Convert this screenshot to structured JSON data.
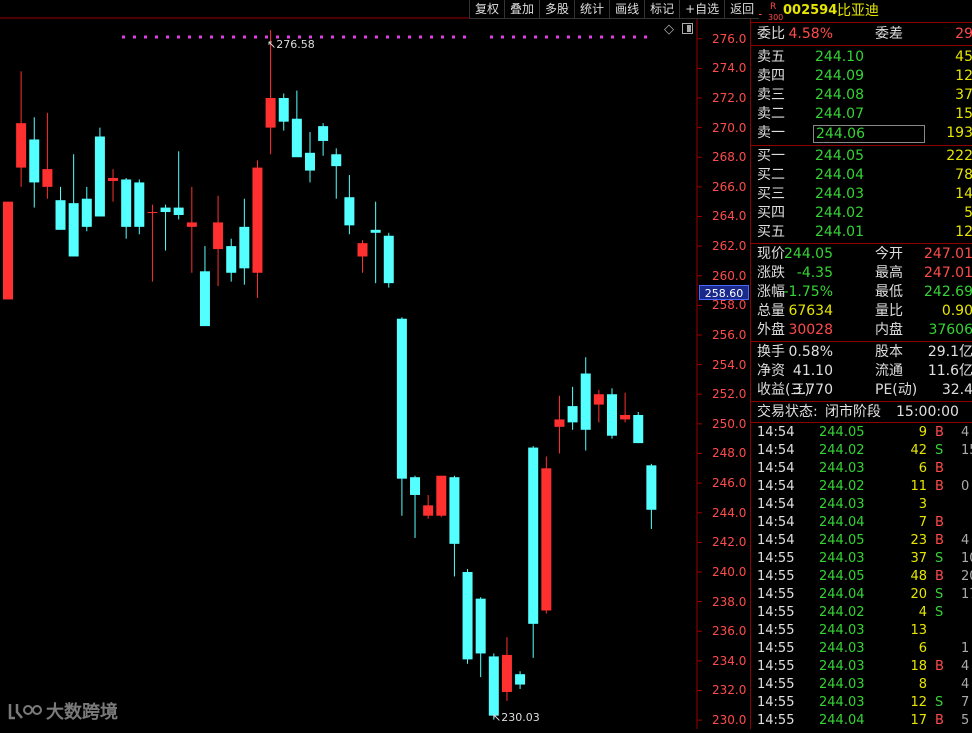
{
  "toolbar": {
    "buttons": [
      "复权",
      "叠加",
      "多股",
      "统计",
      "画线",
      "标记",
      "+自选",
      "返回"
    ]
  },
  "chart": {
    "y_ticks": [
      "276.0",
      "274.0",
      "272.0",
      "270.0",
      "268.0",
      "266.0",
      "264.0",
      "262.0",
      "260.0",
      "258.0",
      "256.0",
      "254.0",
      "252.0",
      "250.0",
      "248.0",
      "246.0",
      "244.0",
      "242.0",
      "240.0",
      "238.0",
      "236.0",
      "234.0",
      "232.0",
      "230.0"
    ],
    "current_price_marker": "258.60",
    "high_annotation": "276.58",
    "low_annotation": "230.03",
    "up_color": "#ff3030",
    "down_color": "#54ffff"
  },
  "chart_data": {
    "type": "candlestick",
    "ylim": [
      229.4,
      277.4
    ],
    "candles": [
      {
        "o": 258.4,
        "h": 265.0,
        "l": 258.4,
        "c": 265.0
      },
      {
        "o": 267.3,
        "h": 273.8,
        "l": 266.0,
        "c": 270.3
      },
      {
        "o": 269.2,
        "h": 270.7,
        "l": 264.6,
        "c": 266.3
      },
      {
        "o": 266.0,
        "h": 271.0,
        "l": 265.2,
        "c": 267.2
      },
      {
        "o": 265.1,
        "h": 266.0,
        "l": 263.1,
        "c": 263.1
      },
      {
        "o": 264.9,
        "h": 268.2,
        "l": 261.7,
        "c": 261.3
      },
      {
        "o": 265.2,
        "h": 266.0,
        "l": 263.0,
        "c": 263.3
      },
      {
        "o": 269.4,
        "h": 270.0,
        "l": 264.0,
        "c": 264.0
      },
      {
        "o": 266.4,
        "h": 267.2,
        "l": 265.0,
        "c": 266.6
      },
      {
        "o": 266.5,
        "h": 266.6,
        "l": 262.5,
        "c": 263.3
      },
      {
        "o": 266.3,
        "h": 266.5,
        "l": 262.8,
        "c": 263.3
      },
      {
        "o": 264.3,
        "h": 264.8,
        "l": 259.6,
        "c": 264.3
      },
      {
        "o": 264.6,
        "h": 264.8,
        "l": 261.7,
        "c": 264.3
      },
      {
        "o": 264.6,
        "h": 268.4,
        "l": 263.8,
        "c": 264.1
      },
      {
        "o": 263.3,
        "h": 266.0,
        "l": 260.2,
        "c": 263.6
      },
      {
        "o": 260.3,
        "h": 262.0,
        "l": 256.6,
        "c": 256.6
      },
      {
        "o": 261.8,
        "h": 265.4,
        "l": 259.3,
        "c": 263.6
      },
      {
        "o": 262.0,
        "h": 262.5,
        "l": 259.6,
        "c": 260.2
      },
      {
        "o": 263.3,
        "h": 265.2,
        "l": 259.4,
        "c": 260.5
      },
      {
        "o": 260.2,
        "h": 267.8,
        "l": 258.5,
        "c": 267.3
      },
      {
        "o": 270.0,
        "h": 276.58,
        "l": 268.2,
        "c": 272.0
      },
      {
        "o": 272.0,
        "h": 272.3,
        "l": 269.8,
        "c": 270.4
      },
      {
        "o": 270.6,
        "h": 272.5,
        "l": 268.2,
        "c": 268.0
      },
      {
        "o": 268.3,
        "h": 269.7,
        "l": 266.3,
        "c": 267.1
      },
      {
        "o": 270.1,
        "h": 270.3,
        "l": 268.1,
        "c": 269.1
      },
      {
        "o": 268.2,
        "h": 268.6,
        "l": 265.2,
        "c": 267.4
      },
      {
        "o": 265.3,
        "h": 266.8,
        "l": 262.8,
        "c": 263.4
      },
      {
        "o": 261.3,
        "h": 262.4,
        "l": 260.2,
        "c": 262.2
      },
      {
        "o": 263.1,
        "h": 265.0,
        "l": 259.5,
        "c": 262.9
      },
      {
        "o": 262.7,
        "h": 262.9,
        "l": 259.2,
        "c": 259.5
      },
      {
        "o": 257.1,
        "h": 257.2,
        "l": 243.8,
        "c": 246.3
      },
      {
        "o": 246.4,
        "h": 246.5,
        "l": 242.3,
        "c": 245.2
      },
      {
        "o": 243.8,
        "h": 245.2,
        "l": 243.6,
        "c": 244.5
      },
      {
        "o": 243.8,
        "h": 246.4,
        "l": 243.7,
        "c": 246.5
      },
      {
        "o": 246.4,
        "h": 246.5,
        "l": 239.7,
        "c": 241.9
      },
      {
        "o": 240.0,
        "h": 240.2,
        "l": 233.8,
        "c": 234.1
      },
      {
        "o": 238.2,
        "h": 238.3,
        "l": 232.9,
        "c": 234.5
      },
      {
        "o": 234.3,
        "h": 234.5,
        "l": 230.03,
        "c": 230.3
      },
      {
        "o": 231.9,
        "h": 235.6,
        "l": 231.3,
        "c": 234.4
      },
      {
        "o": 233.1,
        "h": 233.3,
        "l": 232.1,
        "c": 232.4
      },
      {
        "o": 248.4,
        "h": 248.5,
        "l": 234.2,
        "c": 236.5
      },
      {
        "o": 237.4,
        "h": 247.8,
        "l": 237.2,
        "c": 247.0
      },
      {
        "o": 249.8,
        "h": 251.9,
        "l": 248.0,
        "c": 250.3
      },
      {
        "o": 251.2,
        "h": 252.5,
        "l": 249.6,
        "c": 250.1
      },
      {
        "o": 253.4,
        "h": 254.5,
        "l": 248.2,
        "c": 249.6
      },
      {
        "o": 251.3,
        "h": 252.3,
        "l": 250.1,
        "c": 252.0
      },
      {
        "o": 252.0,
        "h": 252.4,
        "l": 249.0,
        "c": 249.2
      },
      {
        "o": 250.3,
        "h": 252.1,
        "l": 250.1,
        "c": 250.6
      },
      {
        "o": 250.6,
        "h": 250.8,
        "l": 248.7,
        "c": 248.7
      },
      {
        "o": 247.2,
        "h": 247.3,
        "l": 242.9,
        "c": 244.2
      }
    ]
  },
  "quote": {
    "stock_code": "002594",
    "stock_name": "比亚迪",
    "badge_l": "L",
    "badge_r": "R",
    "badge_300": "300",
    "weibi_label": "委比",
    "weibi_value": "4.58%",
    "weicha_label": "委差",
    "weicha_value": "29",
    "asks": [
      {
        "label": "卖五",
        "price": "244.10",
        "vol": "45"
      },
      {
        "label": "卖四",
        "price": "244.09",
        "vol": "12"
      },
      {
        "label": "卖三",
        "price": "244.08",
        "vol": "37"
      },
      {
        "label": "卖二",
        "price": "244.07",
        "vol": "15"
      },
      {
        "label": "卖一",
        "price": "244.06",
        "vol": "193"
      }
    ],
    "bids": [
      {
        "label": "买一",
        "price": "244.05",
        "vol": "222"
      },
      {
        "label": "买二",
        "price": "244.04",
        "vol": "78"
      },
      {
        "label": "买三",
        "price": "244.03",
        "vol": "14"
      },
      {
        "label": "买四",
        "price": "244.02",
        "vol": "5"
      },
      {
        "label": "买五",
        "price": "244.01",
        "vol": "12"
      }
    ],
    "stats": [
      {
        "l1": "现价",
        "v1": "244.05",
        "c1": "green",
        "l2": "今开",
        "v2": "247.01",
        "c2": "red"
      },
      {
        "l1": "涨跌",
        "v1": "-4.35",
        "c1": "green",
        "l2": "最高",
        "v2": "247.01",
        "c2": "red"
      },
      {
        "l1": "涨幅",
        "v1": "-1.75%",
        "c1": "green",
        "l2": "最低",
        "v2": "242.69",
        "c2": "green"
      },
      {
        "l1": "总量",
        "v1": "67634",
        "c1": "yellow",
        "l2": "量比",
        "v2": "0.90",
        "c2": "yellow"
      },
      {
        "l1": "外盘",
        "v1": "30028",
        "c1": "red",
        "l2": "内盘",
        "v2": "37606",
        "c2": "green"
      }
    ],
    "stats2": [
      {
        "l1": "换手",
        "v1": "0.58%",
        "l2": "股本",
        "v2": "29.1亿"
      },
      {
        "l1": "净资",
        "v1": "41.10",
        "l2": "流通",
        "v2": "11.6亿"
      },
      {
        "l1": "收益(三)",
        "v1": "3.770",
        "l2": "PE(动)",
        "v2": "32.4"
      }
    ],
    "status_label": "交易状态:",
    "status_value": "闭市阶段",
    "status_time": "15:00:00"
  },
  "ticks": [
    {
      "t": "14:54",
      "p": "244.05",
      "v": "9",
      "d": "B",
      "x": "4"
    },
    {
      "t": "14:54",
      "p": "244.02",
      "v": "42",
      "d": "S",
      "x": "15"
    },
    {
      "t": "14:54",
      "p": "244.03",
      "v": "6",
      "d": "B",
      "x": ""
    },
    {
      "t": "14:54",
      "p": "244.02",
      "v": "11",
      "d": "B",
      "x": "0"
    },
    {
      "t": "14:54",
      "p": "244.03",
      "v": "3",
      "d": "",
      "x": ""
    },
    {
      "t": "14:54",
      "p": "244.04",
      "v": "7",
      "d": "B",
      "x": ""
    },
    {
      "t": "14:54",
      "p": "244.05",
      "v": "23",
      "d": "B",
      "x": "4"
    },
    {
      "t": "14:55",
      "p": "244.03",
      "v": "37",
      "d": "S",
      "x": "10"
    },
    {
      "t": "14:55",
      "p": "244.05",
      "v": "48",
      "d": "B",
      "x": "20"
    },
    {
      "t": "14:55",
      "p": "244.04",
      "v": "20",
      "d": "S",
      "x": "17"
    },
    {
      "t": "14:55",
      "p": "244.02",
      "v": "4",
      "d": "S",
      "x": ""
    },
    {
      "t": "14:55",
      "p": "244.03",
      "v": "13",
      "d": "",
      "x": ""
    },
    {
      "t": "14:55",
      "p": "244.03",
      "v": "6",
      "d": "",
      "x": "1"
    },
    {
      "t": "14:55",
      "p": "244.03",
      "v": "18",
      "d": "B",
      "x": "4"
    },
    {
      "t": "14:55",
      "p": "244.03",
      "v": "8",
      "d": "",
      "x": "4"
    },
    {
      "t": "14:55",
      "p": "244.03",
      "v": "12",
      "d": "S",
      "x": "7"
    },
    {
      "t": "14:55",
      "p": "244.04",
      "v": "17",
      "d": "B",
      "x": "5"
    }
  ],
  "watermark": {
    "logo_text": "大数跨境"
  }
}
